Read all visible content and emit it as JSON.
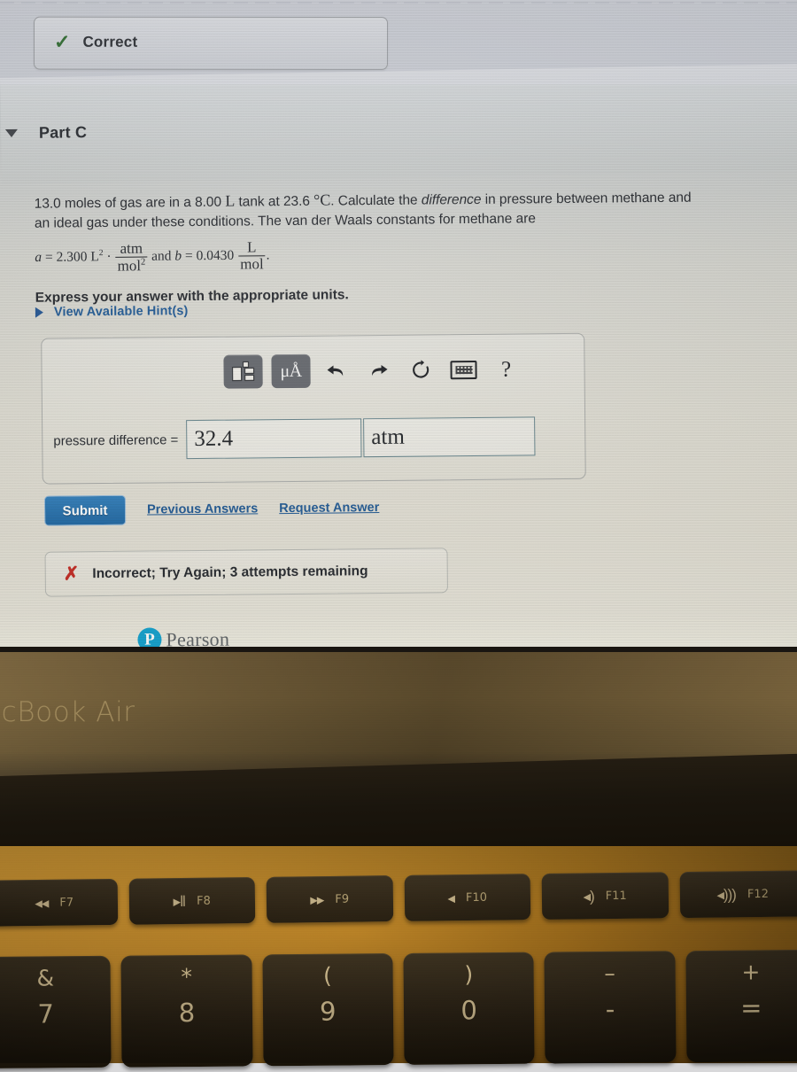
{
  "screen": {
    "correct_banner": {
      "icon": "check-icon",
      "label": "Correct"
    },
    "part": {
      "toggle_icon": "triangle-down-icon",
      "title": "Part C"
    },
    "problem": {
      "line1_a": "13.0 moles of gas are in a 8.00 ",
      "line1_L": "L",
      "line1_b": " tank at 23.6 ",
      "line1_C": "°C",
      "line1_c": ". Calculate the ",
      "line1_em": "difference",
      "line1_d": " in pressure between methane and",
      "line2": "an ideal gas under these conditions. The van der Waals constants for methane are",
      "formula_a_sym": "a",
      "formula_a_eq": "= 2.300 L",
      "formula_a_exp": "2",
      "formula_a_dot": "·",
      "formula_a_unit_num": "atm",
      "formula_a_unit_den": "mol",
      "formula_a_unit_exp": "2",
      "formula_and": " and ",
      "formula_b_sym": "b",
      "formula_b_eq": "= 0.0430 ",
      "formula_b_unit_num": "L",
      "formula_b_unit_den": "mol",
      "formula_period": ".",
      "express": "Express your answer with the appropriate units."
    },
    "hints": {
      "toggle_icon": "triangle-right-icon",
      "label": "View Available Hint(s)"
    },
    "answer_panel": {
      "toolbar": [
        {
          "name": "template-icon",
          "glyph": "",
          "type": "button"
        },
        {
          "name": "units-micro-angstrom-icon",
          "glyph": "μÅ",
          "type": "button"
        },
        {
          "name": "undo-icon",
          "glyph": "↩",
          "type": "plain"
        },
        {
          "name": "redo-icon",
          "glyph": "↪",
          "type": "plain"
        },
        {
          "name": "reset-icon",
          "glyph": "↻",
          "type": "plain"
        },
        {
          "name": "keyboard-icon",
          "glyph": "",
          "type": "plain"
        },
        {
          "name": "help-icon",
          "glyph": "?",
          "type": "plain"
        }
      ],
      "field_label": "pressure difference =",
      "value": "32.4",
      "units": "atm"
    },
    "actions": {
      "submit_label": "Submit",
      "previous_answers_label": "Previous Answers",
      "request_answer_label": "Request Answer"
    },
    "feedback": {
      "icon": "x-icon",
      "label": "Incorrect; Try Again; 3 attempts remaining"
    },
    "footer": {
      "logo_mark": "P",
      "logo_word": "Pearson"
    }
  },
  "laptop": {
    "model_label": "acBook Air",
    "function_keys": [
      {
        "glyph": "◂◂",
        "name": "rewind-icon",
        "label": "F7"
      },
      {
        "glyph": "▸‖",
        "name": "play-pause-icon",
        "label": "F8"
      },
      {
        "glyph": "▸▸",
        "name": "fast-forward-icon",
        "label": "F9"
      },
      {
        "glyph": "◂",
        "name": "mute-icon",
        "label": "F10"
      },
      {
        "glyph": "◂)",
        "name": "volume-down-icon",
        "label": "F11"
      },
      {
        "glyph": "◂)))",
        "name": "volume-up-icon",
        "label": "F12"
      }
    ],
    "number_keys": [
      {
        "upper": "&",
        "lower": "7"
      },
      {
        "upper": "*",
        "lower": "8"
      },
      {
        "upper": "(",
        "lower": "9"
      },
      {
        "upper": ")",
        "lower": "0"
      },
      {
        "upper": "–",
        "lower": "-"
      },
      {
        "upper": "+",
        "lower": "="
      }
    ]
  },
  "colors": {
    "submit_blue": "#1c6cb0",
    "link_blue": "#17528f",
    "correct_green": "#2d6a2f",
    "incorrect_red": "#c2231c",
    "pearson_cyan": "#0aa0cf",
    "deck_gold": "#cf8f24",
    "bezel_brown": "#6a5634"
  }
}
